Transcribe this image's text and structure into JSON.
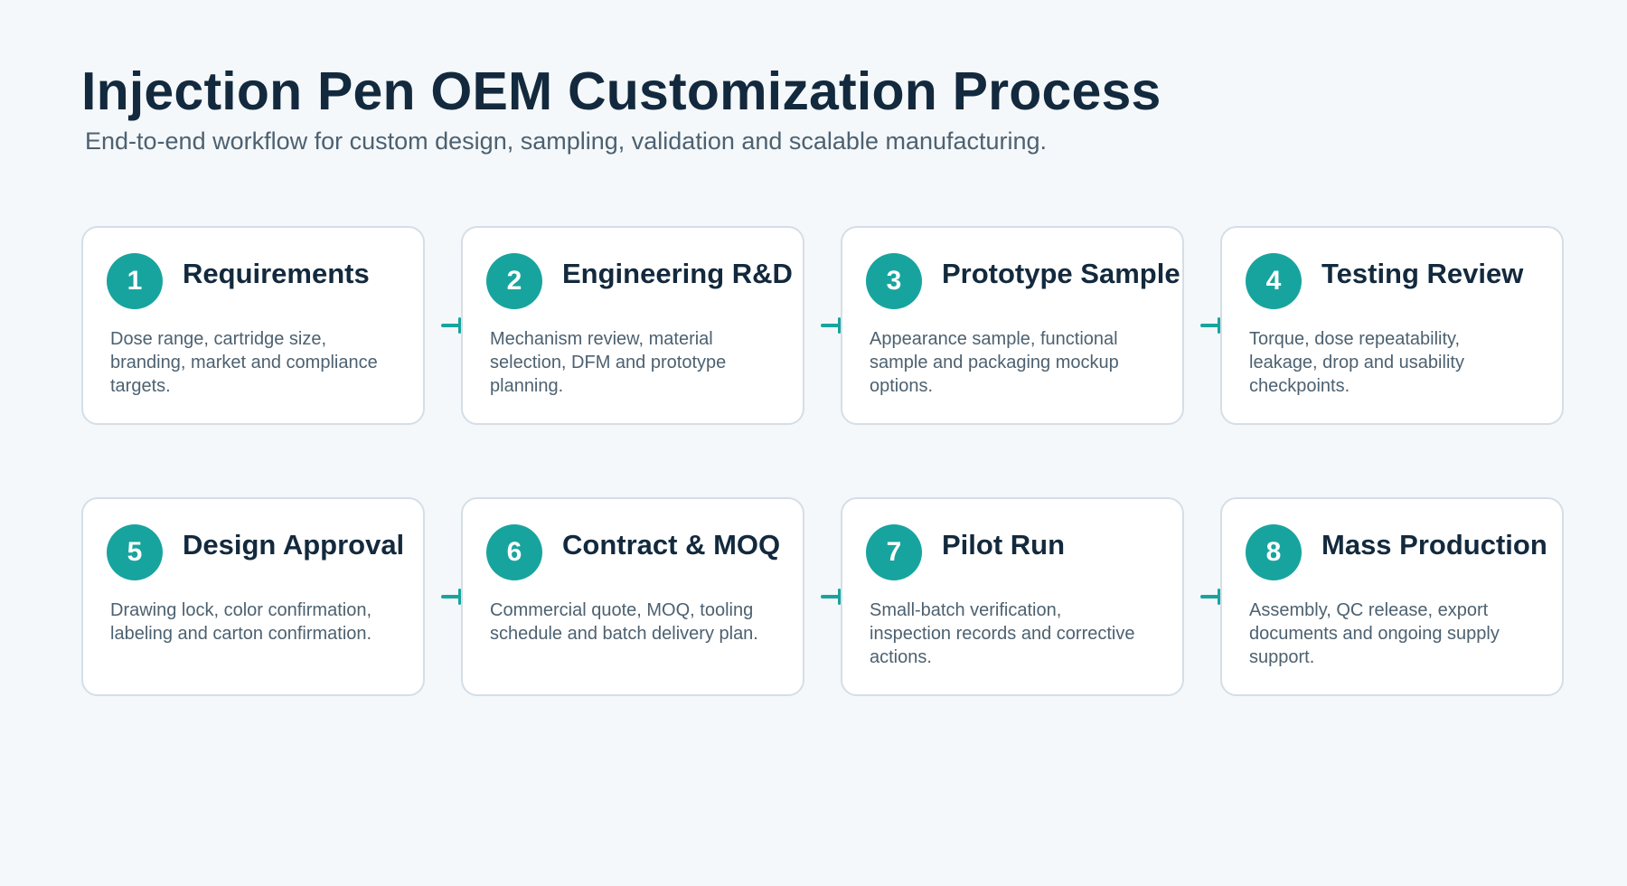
{
  "page": {
    "title": "Injection Pen OEM Customization Process",
    "subtitle": "End-to-end workflow for custom design, sampling, validation and scalable manufacturing."
  },
  "colors": {
    "accent": "#18a49e",
    "title": "#13293d",
    "body_text": "#4d6170",
    "card_border": "#d5dee6",
    "background": "#f4f8fb",
    "card_background": "#ffffff"
  },
  "steps": [
    {
      "number": "1",
      "title": "Requirements",
      "description": "Dose range, cartridge size, branding, market and compliance targets."
    },
    {
      "number": "2",
      "title": "Engineering R&D",
      "description": "Mechanism review, material selection, DFM and prototype planning."
    },
    {
      "number": "3",
      "title": "Prototype Sample",
      "description": "Appearance sample, functional sample and packaging mockup options."
    },
    {
      "number": "4",
      "title": "Testing Review",
      "description": "Torque, dose repeatability, leakage, drop and usability checkpoints."
    },
    {
      "number": "5",
      "title": "Design Approval",
      "description": "Drawing lock, color confirmation, labeling and carton confirmation."
    },
    {
      "number": "6",
      "title": "Contract & MOQ",
      "description": "Commercial quote, MOQ, tooling schedule and batch delivery plan."
    },
    {
      "number": "7",
      "title": "Pilot Run",
      "description": "Small-batch verification, inspection records and corrective actions."
    },
    {
      "number": "8",
      "title": "Mass Production",
      "description": "Assembly, QC release, export documents and ongoing supply support."
    }
  ]
}
